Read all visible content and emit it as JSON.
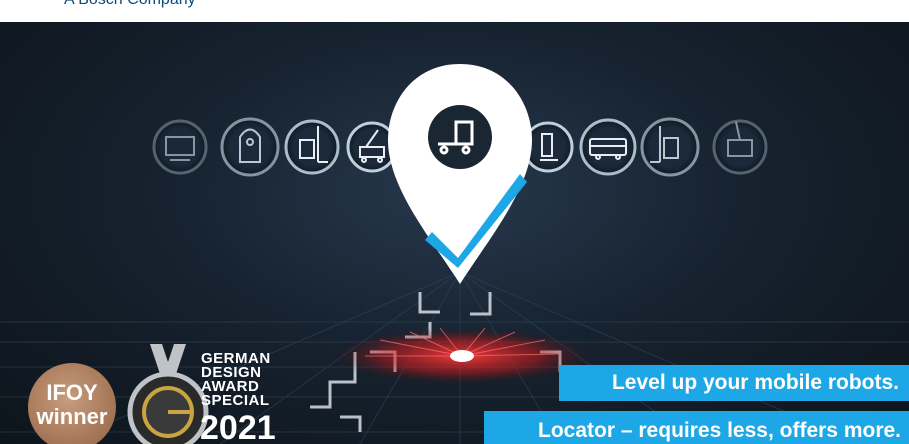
{
  "header": {
    "company_text": "A Bosch Company"
  },
  "banner": {
    "headline": "Level up your mobile robots.",
    "subline": "Locator – requires less, offers more.",
    "award_ifoy": {
      "line1": "IFOY",
      "line2": "winner"
    },
    "award_german_design": {
      "lines": [
        "GERMAN",
        "DESIGN",
        "AWARD",
        "SPECIAL"
      ],
      "year": "2021"
    },
    "vehicle_icons": [
      "cart-icon",
      "robot-icon",
      "forklift-icon",
      "crane-icon",
      "truck-icon",
      "pallet-truck-icon",
      "bus-icon",
      "forklift-icon",
      "tugger-icon"
    ]
  },
  "colors": {
    "accent": "#1ea7e6",
    "ifoy_bronze": "#a7795a",
    "header_text": "#0a4b7a",
    "floor_glow": "#e4262c"
  }
}
